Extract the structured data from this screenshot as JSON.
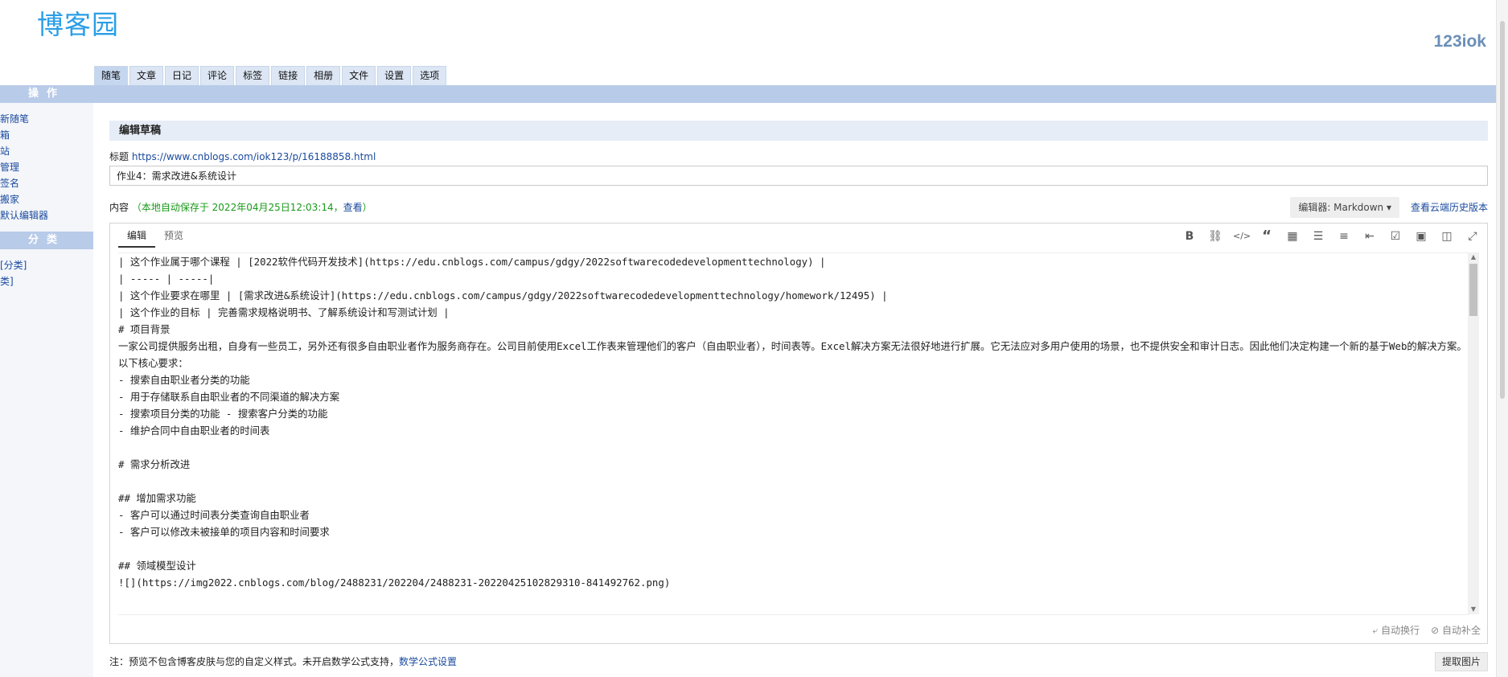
{
  "header": {
    "logo": "博客园",
    "username": "123iok"
  },
  "tabs": [
    "随笔",
    "文章",
    "日记",
    "评论",
    "标签",
    "链接",
    "相册",
    "文件",
    "设置",
    "选项"
  ],
  "sidebar": {
    "ops_header": "操作",
    "ops_items": [
      "新随笔",
      "箱",
      "站",
      "管理",
      "签名",
      "搬家",
      "默认编辑器"
    ],
    "cat_header": "分类",
    "cat_items": [
      "[分类]",
      "类]"
    ]
  },
  "main": {
    "section_title": "编辑草稿",
    "title_label": "标题",
    "title_link": "https://www.cnblogs.com/iok123/p/16188858.html",
    "title_value": "作业4：需求改进&系统设计",
    "content_label": "内容",
    "autosave_text": "（本地自动保存于 2022年04月25日12:03:14，",
    "autosave_view": "查看",
    "autosave_close": "）",
    "editor_select": "编辑器: Markdown ▾",
    "cloud_history": "查看云端历史版本",
    "editor_tabs": [
      "编辑",
      "预览"
    ],
    "toolbar_icons": [
      "bold-icon",
      "link-icon",
      "code-icon",
      "quote-icon",
      "table-icon",
      "bullet-list-icon",
      "numbered-list-icon",
      "indent-icon",
      "checkbox-icon",
      "image-icon",
      "split-view-icon",
      "fullscreen-icon"
    ],
    "lines": [
      "| 这个作业属于哪个课程 | [2022软件代码开发技术](https://edu.cnblogs.com/campus/gdgy/2022softwarecodedevelopmenttechnology) |",
      "| ----- | -----|",
      "| 这个作业要求在哪里 | [需求改进&系统设计](https://edu.cnblogs.com/campus/gdgy/2022softwarecodedevelopmenttechnology/homework/12495) |",
      "| 这个作业的目标 | 完善需求规格说明书、了解系统设计和写测试计划 |",
      "# 项目背景",
      "一家公司提供服务出租，自身有一些员工，另外还有很多自由职业者作为服务商存在。公司目前使用Excel工作表来管理他们的客户（自由职业者），时间表等。Excel解决方案无法很好地进行扩展。它无法应对多用户使用的场景，也不提供安全和审计日志。因此他们决定构建一个新的基于Web的解决方案。以下核心要求：",
      "- 搜索自由职业者分类的功能",
      "- 用于存储联系自由职业者的不同渠道的解决方案",
      "- 搜索项目分类的功能 - 搜索客户分类的功能",
      "- 维护合同中自由职业者的时间表",
      "",
      "# 需求分析改进",
      "",
      "## 增加需求功能",
      "- 客户可以通过时间表分类查询自由职业者",
      "- 客户可以修改未被接单的项目内容和时间要求",
      "",
      "## 领域模型设计",
      "![](https://img2022.cnblogs.com/blog/2488231/202204/2488231-20220425102829310-841492762.png)"
    ],
    "footer_wrap": "自动换行",
    "footer_autocomplete": "自动补全",
    "note_text": "注：预览不包含博客皮肤与您的自定义样式。未开启数学公式支持，",
    "note_link": "数学公式设置",
    "extract_img": "提取图片"
  }
}
